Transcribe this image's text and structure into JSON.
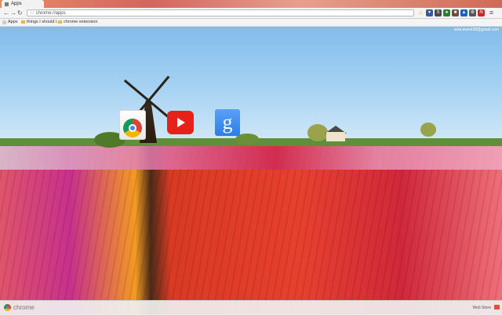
{
  "tab": {
    "title": "Apps"
  },
  "omnibox": {
    "url": "chrome://apps"
  },
  "bookmarks": [
    {
      "label": "Apps",
      "type": "apps"
    },
    {
      "label": "things I should l...",
      "type": "folder"
    },
    {
      "label": "chrome extension",
      "type": "folder"
    }
  ],
  "account": {
    "email": "seta.ewest38@gmail.com"
  },
  "apps": [
    {
      "name": "Chrome Web Store",
      "icon": "chrome-icon"
    },
    {
      "name": "YouTube",
      "icon": "youtube-icon"
    },
    {
      "name": "Google Search",
      "icon": "google-icon",
      "letter": "g"
    }
  ],
  "bottom": {
    "brand": "chrome",
    "webstore": "Web Store"
  },
  "colors": {
    "youtube": "#e62117",
    "google": "#2d7de6",
    "accent": "#db4437"
  }
}
